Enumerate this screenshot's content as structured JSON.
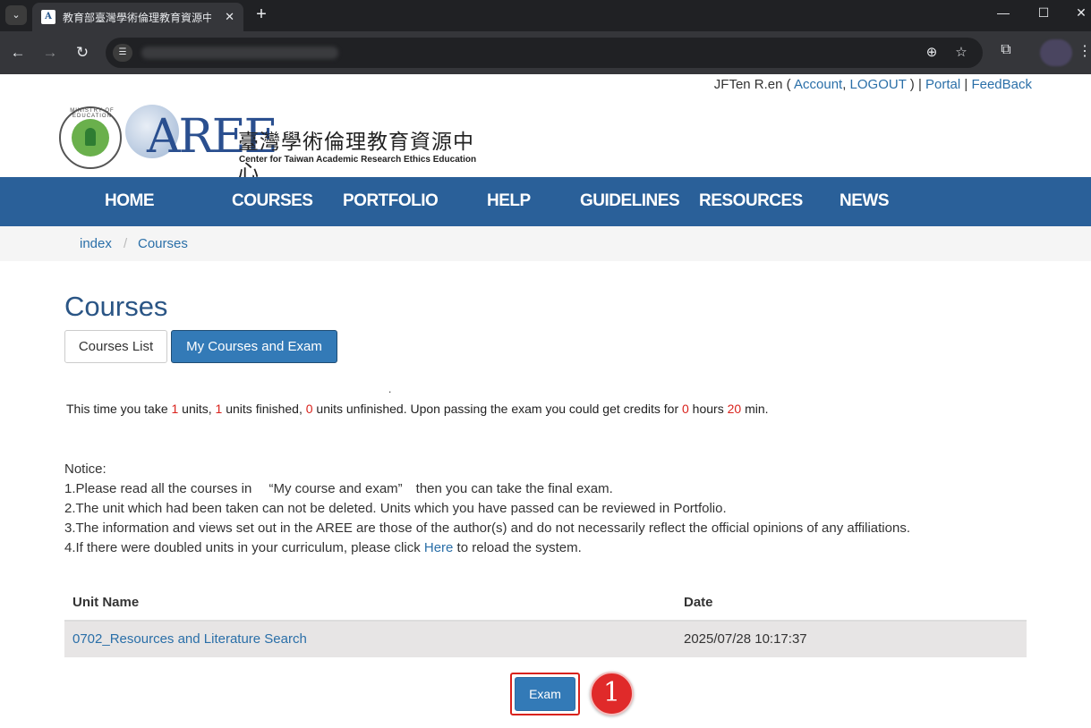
{
  "browser": {
    "tab_title": "教育部臺灣學術倫理教育資源中心",
    "tab_close": "✕",
    "new_tab": "+"
  },
  "user": {
    "name": "JFTen R.en",
    "account_label": "Account",
    "logout_label": "LOGOUT",
    "portal_label": "Portal",
    "feedback_label": "FeedBack"
  },
  "logo": {
    "brand": "AREE",
    "chinese_name": "臺灣學術倫理教育資源中心",
    "english_name": "Center for Taiwan Academic Research Ethics Education",
    "seal_text": "MINISTRY OF EDUCATION"
  },
  "nav": {
    "items": [
      "HOME",
      "COURSES",
      "PORTFOLIO",
      "HELP",
      "GUIDELINES",
      "RESOURCES",
      "NEWS"
    ]
  },
  "breadcrumb": {
    "items": [
      "index",
      "Courses"
    ],
    "separator": "/"
  },
  "main": {
    "title": "Courses",
    "tab_courses_list": "Courses List",
    "tab_my_courses": "My Courses and Exam",
    "dot": "."
  },
  "summary": {
    "p1": "This time you take ",
    "units_taken": "1",
    "p2": " units, ",
    "units_finished": "1",
    "p3": " units finished, ",
    "units_unfinished": "0",
    "p4": " units unfinished. Upon passing the exam you could get credits for ",
    "hours": "0",
    "p5": " hours ",
    "minutes": "20",
    "p6": " min."
  },
  "notice": {
    "heading": "Notice:",
    "line1": "1.Please read all the courses in 　“My course and exam”　then you can take the final exam.",
    "line2": "2.The unit which had been taken can not be deleted. Units which you have passed can be reviewed in Portfolio.",
    "line3": "3.The information and views set out in the AREE are those of the author(s) and do not necessarily reflect the official opinions of any affiliations.",
    "line4_pre": "4.If there were doubled units in your curriculum, please click ",
    "line4_link": "Here",
    "line4_post": " to reload the system."
  },
  "table": {
    "headers": [
      "Unit Name",
      "Date"
    ],
    "rows": [
      {
        "unit": "0702_Resources and Literature Search",
        "date": "2025/07/28 10:17:37"
      }
    ]
  },
  "actions": {
    "exam_label": "Exam",
    "step_number": "1"
  },
  "colors": {
    "nav_bg": "#2a6099",
    "link": "#2a6fa8",
    "primary_button": "#337ab7",
    "highlight_red": "#d9221c"
  }
}
